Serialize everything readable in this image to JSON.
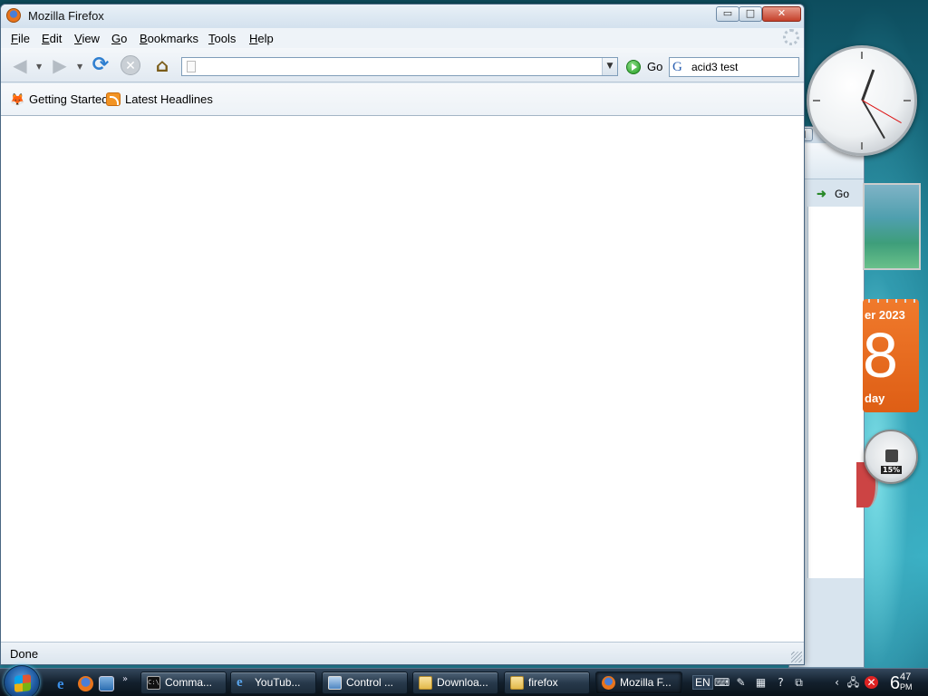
{
  "window": {
    "title": "Mozilla Firefox",
    "controls": {
      "minimize": "▭",
      "maximize": "□",
      "close": "✕"
    }
  },
  "menubar": {
    "items": [
      {
        "label": "File",
        "accel": "F",
        "rest": "ile"
      },
      {
        "label": "Edit",
        "accel": "E",
        "rest": "dit"
      },
      {
        "label": "View",
        "accel": "V",
        "rest": "iew"
      },
      {
        "label": "Go",
        "accel": "G",
        "rest": "o"
      },
      {
        "label": "Bookmarks",
        "accel": "B",
        "rest": "ookmarks"
      },
      {
        "label": "Tools",
        "accel": "T",
        "rest": "ools"
      },
      {
        "label": "Help",
        "accel": "H",
        "rest": "elp"
      }
    ]
  },
  "navbar": {
    "back_icon": "back-arrow-icon",
    "forward_icon": "forward-arrow-icon",
    "reload_icon": "reload-icon",
    "stop_icon": "stop-icon",
    "home_icon": "home-icon",
    "url_value": "",
    "url_placeholder": "",
    "go_label": "Go",
    "search_value": "acid3 test",
    "search_engine_glyph": "G"
  },
  "bookmarks": {
    "items": [
      {
        "label": "Getting Started",
        "icon": "firefox-bookmark-icon"
      },
      {
        "label": "Latest Headlines",
        "icon": "rss-feed-icon"
      }
    ]
  },
  "status": {
    "text": "Done"
  },
  "background_window": {
    "go_label": "Go",
    "controls": {
      "maximize": "□",
      "close": "✕"
    }
  },
  "gadgets": {
    "calendar": {
      "month_fragment": "er 2023",
      "day": "8",
      "weekday_fragment": "day"
    },
    "cpu_meter": {
      "percent": "15%"
    }
  },
  "taskbar": {
    "quick_launch_more": "»",
    "tasks": [
      {
        "label": "Comma...",
        "icon": "cmd"
      },
      {
        "label": "YouTub...",
        "icon": "ie"
      },
      {
        "label": "Control ...",
        "icon": "cp"
      },
      {
        "label": "Downloa...",
        "icon": "folder"
      },
      {
        "label": "firefox",
        "icon": "folder"
      },
      {
        "label": "Mozilla F...",
        "icon": "fx"
      }
    ],
    "tray": {
      "language": "EN",
      "clock_hour": "6",
      "clock_minute": "47",
      "clock_ampm": "PM"
    }
  },
  "colors": {
    "accent": "#2f7fd0",
    "go_green": "#1e9a1e",
    "calendar_orange": "#e86a1f"
  }
}
